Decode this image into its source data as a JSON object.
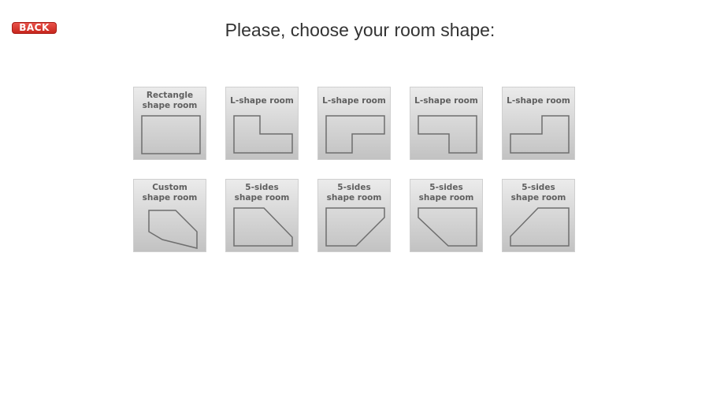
{
  "header": {
    "back_label": "BACK",
    "title": "Please, choose your room shape:"
  },
  "shapes": [
    {
      "label": "Rectangle\nshape room",
      "icon": "rectangle-room-icon"
    },
    {
      "label": "L-shape room",
      "icon": "l-shape-room-icon"
    },
    {
      "label": "L-shape room",
      "icon": "l-shape-room-icon"
    },
    {
      "label": "L-shape room",
      "icon": "l-shape-room-icon"
    },
    {
      "label": "L-shape room",
      "icon": "l-shape-room-icon"
    },
    {
      "label": "Custom\nshape room",
      "icon": "custom-room-icon"
    },
    {
      "label": "5-sides\nshape room",
      "icon": "five-sided-room-icon"
    },
    {
      "label": "5-sides\nshape room",
      "icon": "five-sided-room-icon"
    },
    {
      "label": "5-sides\nshape room",
      "icon": "five-sided-room-icon"
    },
    {
      "label": "5-sides\nshape room",
      "icon": "five-sided-room-icon"
    }
  ],
  "colors": {
    "back_button": "#d9342b",
    "outline": "#6e6e6e"
  }
}
